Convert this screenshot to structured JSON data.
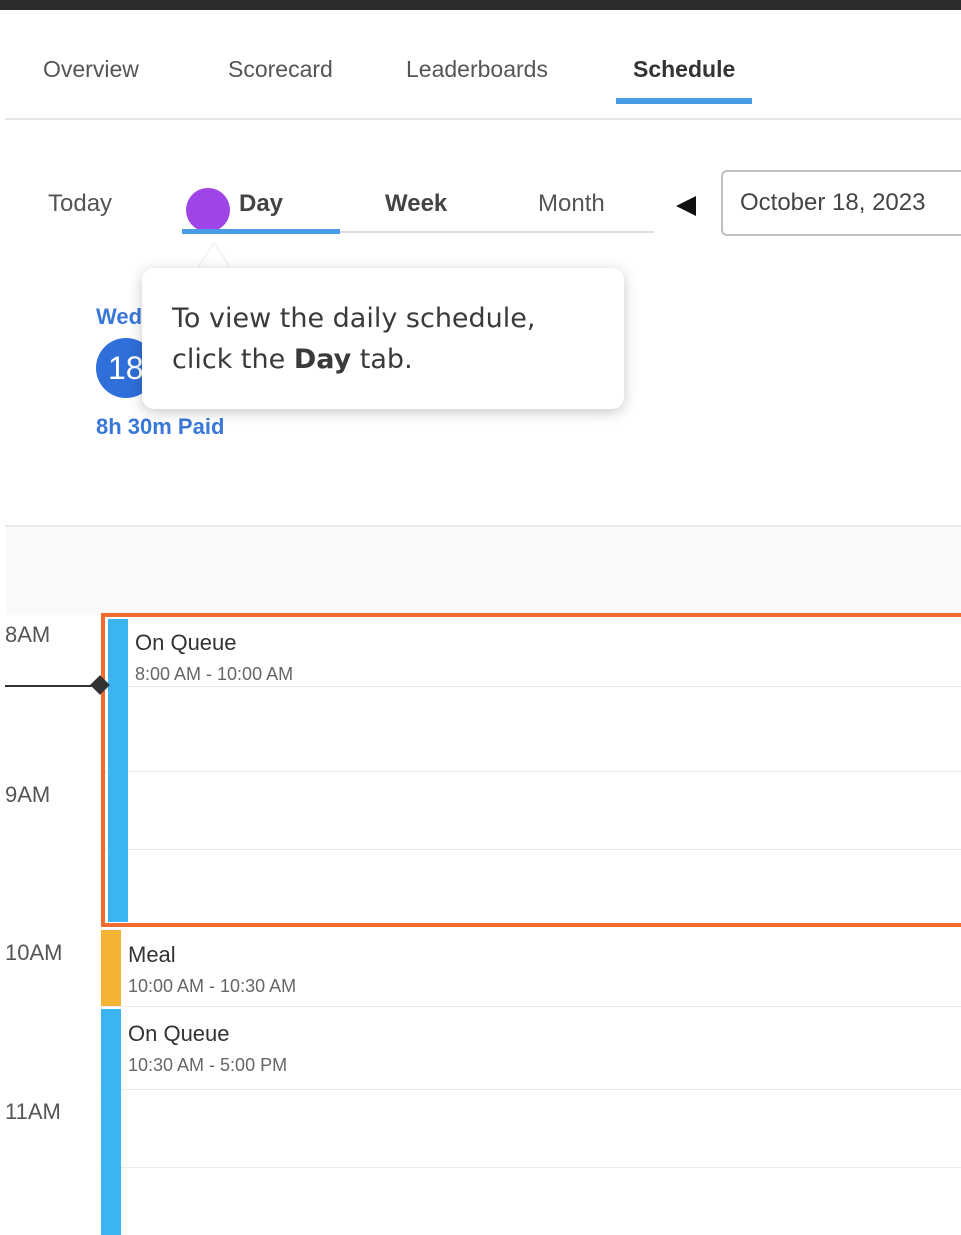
{
  "tabs": [
    {
      "label": "Overview"
    },
    {
      "label": "Scorecard"
    },
    {
      "label": "Leaderboards"
    },
    {
      "label": "Schedule",
      "active": true
    }
  ],
  "view_controls": {
    "today": "Today",
    "day": "Day",
    "week": "Week",
    "month": "Month",
    "selected": "Day",
    "date_value": "October 18, 2023"
  },
  "day_header": {
    "day_name": "Wed",
    "day_number": "18",
    "paid": "8h 30m Paid"
  },
  "tooltip": {
    "line1": "To view the daily schedule,",
    "line2_prefix": "click the ",
    "line2_bold": "Day",
    "line2_suffix": " tab."
  },
  "hours": [
    "8AM",
    "9AM",
    "10AM",
    "11AM"
  ],
  "events": [
    {
      "title": "On Queue",
      "time": "8:00 AM - 10:00 AM",
      "color": "#3db4f2",
      "selected": true
    },
    {
      "title": "Meal",
      "time": "10:00 AM - 10:30 AM",
      "color": "#f5b335"
    },
    {
      "title": "On Queue",
      "time": "10:30 AM - 5:00 PM",
      "color": "#3db4f2"
    }
  ],
  "colors": {
    "accent": "#4a9be8",
    "selection_border": "#f26b2e",
    "cursor": "#9f45e8",
    "day_circle": "#2f6fd9"
  }
}
